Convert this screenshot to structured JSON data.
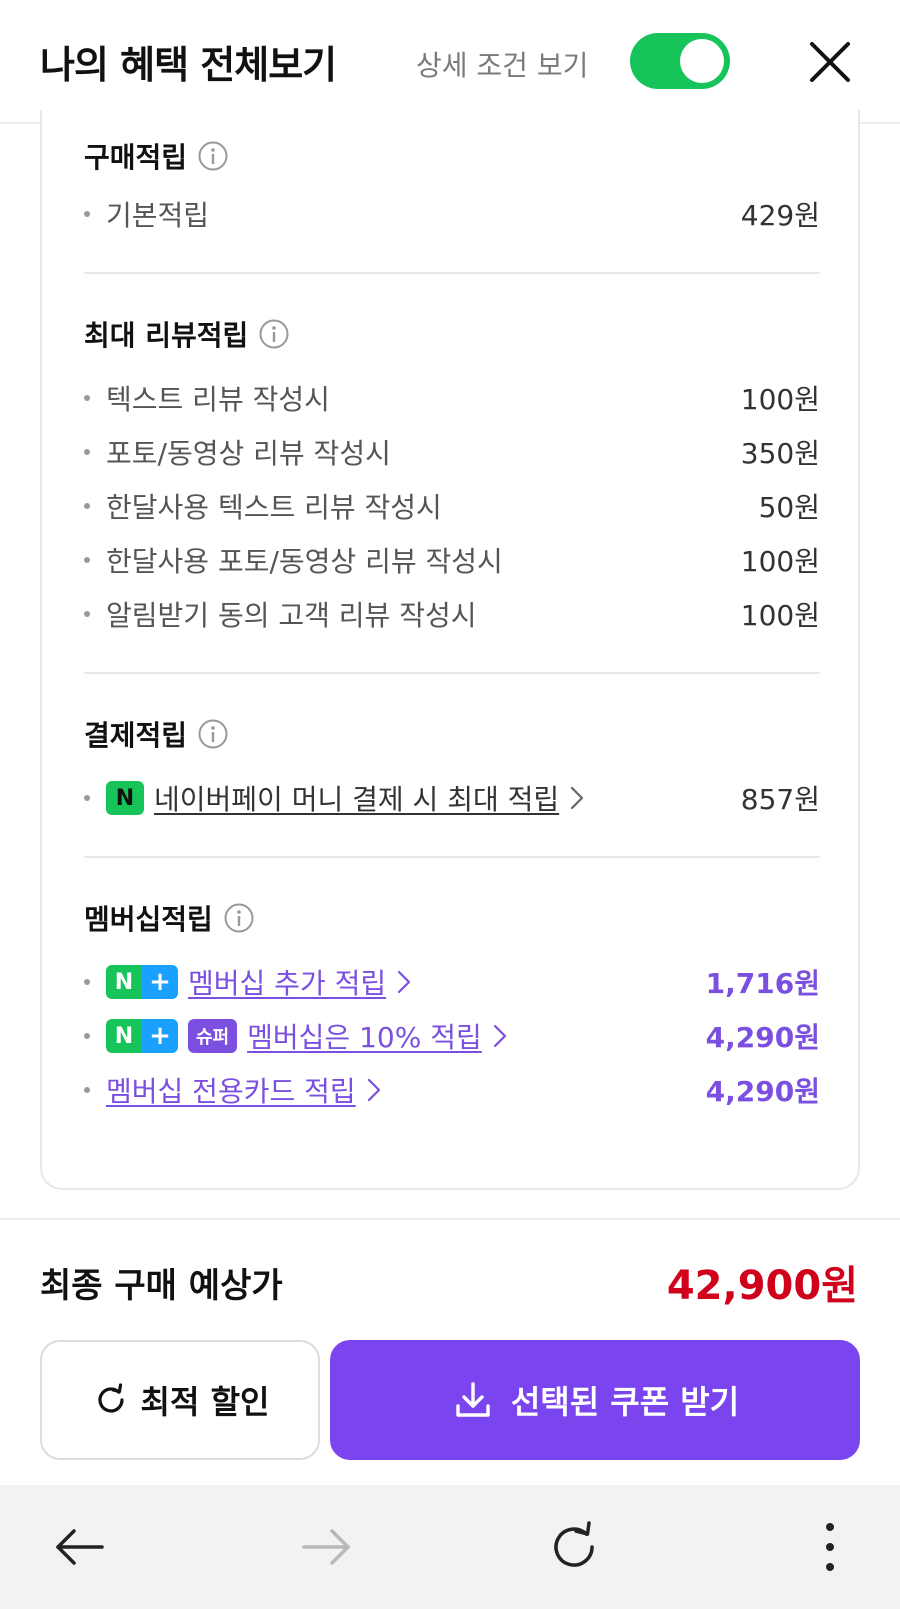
{
  "header": {
    "title": "나의 혜택 전체보기",
    "detail_toggle_label": "상세 조건 보기",
    "toggle_on": true,
    "toggle_color": "#16c45a"
  },
  "sections": {
    "purchase": {
      "title": "구매적립",
      "items": [
        {
          "label": "기본적립",
          "value": "429원"
        }
      ]
    },
    "review": {
      "title": "최대 리뷰적립",
      "items": [
        {
          "label": "텍스트 리뷰 작성시",
          "value": "100원"
        },
        {
          "label": "포토/동영상 리뷰 작성시",
          "value": "350원"
        },
        {
          "label": "한달사용 텍스트 리뷰 작성시",
          "value": "50원"
        },
        {
          "label": "한달사용 포토/동영상 리뷰 작성시",
          "value": "100원"
        },
        {
          "label": "알림받기 동의 고객 리뷰 작성시",
          "value": "100원"
        }
      ]
    },
    "payment": {
      "title": "결제적립",
      "items": [
        {
          "badge": "N",
          "label": "네이버페이 머니 결제 시 최대 적립",
          "value": "857원"
        }
      ]
    },
    "membership": {
      "title": "멤버십적립",
      "items": [
        {
          "badge_n": "N",
          "badge_plus": "+",
          "label": "멤버십 추가 적립",
          "value": "1,716원"
        },
        {
          "badge_n": "N",
          "badge_plus": "+",
          "badge_super": "슈퍼",
          "label": "멤버십은 10% 적립",
          "value": "4,290원"
        },
        {
          "label": "멤버십 전용카드 적립",
          "value": "4,290원"
        }
      ]
    }
  },
  "summary": {
    "final_label": "최종 구매 예상가",
    "final_price": "42,900원",
    "price_color": "#d0021b"
  },
  "buttons": {
    "optimal_discount": "최적 할인",
    "get_coupons": "선택된 쿠폰 받기",
    "accent_color": "#7a45ef"
  },
  "browser_nav": {
    "icons": [
      "back-arrow-icon",
      "forward-arrow-icon",
      "refresh-icon",
      "more-vert-icon"
    ]
  }
}
